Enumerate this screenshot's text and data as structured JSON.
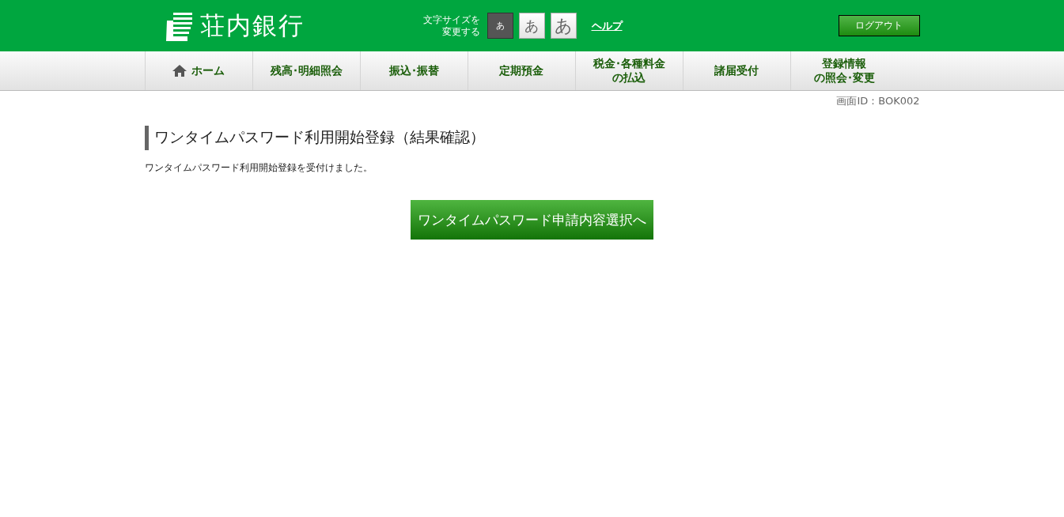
{
  "header": {
    "bank_name": "荘内銀行",
    "font_size_label": [
      "文字サイズを",
      "変更する"
    ],
    "font_sizes": [
      {
        "label": "あ",
        "kind": "small",
        "selected": true
      },
      {
        "label": "あ",
        "kind": "medium",
        "selected": false
      },
      {
        "label": "あ",
        "kind": "large",
        "selected": false
      }
    ],
    "help_link": "ヘルプ",
    "logout_button": "ログアウト"
  },
  "nav": [
    {
      "lines": [
        "ホーム"
      ],
      "kind": "home"
    },
    {
      "lines": [
        "残高･明細照会"
      ],
      "kind": "text"
    },
    {
      "lines": [
        "振込･振替"
      ],
      "kind": "text"
    },
    {
      "lines": [
        "定期預金"
      ],
      "kind": "text"
    },
    {
      "lines": [
        "税金･各種料金",
        "の払込"
      ],
      "kind": "text"
    },
    {
      "lines": [
        "諸届受付"
      ],
      "kind": "text"
    },
    {
      "lines": [
        "登録情報",
        "の照会･変更"
      ],
      "kind": "text"
    }
  ],
  "screen_id": "画面ID：BOK002",
  "page_title": "ワンタイムパスワード利用開始登録（結果確認）",
  "message": "ワンタイムパスワード利用開始登録を受付けました。",
  "action_button": "ワンタイムパスワード申請内容選択へ"
}
